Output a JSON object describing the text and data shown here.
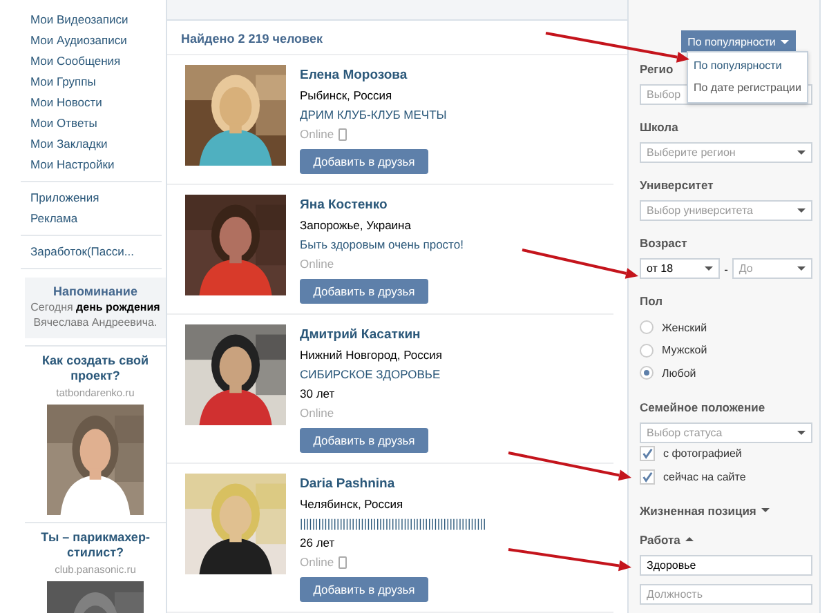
{
  "sidebar": {
    "menu_groups": [
      [
        "Мои Видеозаписи",
        "Мои Аудиозаписи",
        "Мои Сообщения",
        "Мои Группы",
        "Мои Новости",
        "Мои Ответы",
        "Мои Закладки",
        "Мои Настройки"
      ],
      [
        "Приложения",
        "Реклама"
      ],
      [
        "Заработок(Пасси..."
      ]
    ],
    "reminder": {
      "title": "Напоминание",
      "text": "Сегодня **день рождения** Вячеслава Андреевича."
    },
    "ads": [
      {
        "title": "Как создать свой проект?",
        "domain": "tatbondarenko.ru"
      },
      {
        "title": "Ты – парикмахер-стилист?",
        "domain": "club.panasonic.ru"
      }
    ]
  },
  "results": {
    "count": "Найдено 2 219 человек",
    "people": [
      {
        "name": "Елена Морозова",
        "city": "Рыбинск, Россия",
        "status": "ДРИМ КЛУБ-КЛУБ МЕЧТЫ",
        "online": "Online",
        "mobile": true,
        "button": "Добавить в друзья"
      },
      {
        "name": "Яна Костенко",
        "city": "Запорожье, Украина",
        "status": "Быть здоровым очень просто!",
        "online": "Online",
        "mobile": false,
        "button": "Добавить в друзья"
      },
      {
        "name": "Дмитрий Касаткин",
        "city": "Нижний Новгород, Россия",
        "status": "СИБИРСКОЕ ЗДОРОВЬЕ",
        "age": "30 лет",
        "online": "Online",
        "mobile": false,
        "button": "Добавить в друзья"
      },
      {
        "name": "Daria Pashnina",
        "city": "Челябинск, Россия",
        "status": "|||||||||||||||||||||||||||||||||||||||||||||||||||||||||||||",
        "age": "26 лет",
        "online": "Online",
        "mobile": true,
        "button": "Добавить в друзья"
      }
    ]
  },
  "sort": {
    "button": "По популярности",
    "options": [
      {
        "label": "По популярности",
        "selected": true
      },
      {
        "label": "По дате регистрации",
        "selected": false
      }
    ]
  },
  "filters": [
    {
      "kind": "heading",
      "label": "Регио"
    },
    {
      "kind": "select",
      "placeholder": "Выбор"
    },
    {
      "kind": "heading",
      "label": "Школа"
    },
    {
      "kind": "select",
      "placeholder": "Выберите регион"
    },
    {
      "kind": "heading",
      "label": "Университет"
    },
    {
      "kind": "select",
      "placeholder": "Выбор университета"
    },
    {
      "kind": "heading",
      "label": "Возраст"
    },
    {
      "kind": "range",
      "from": {
        "value": "от 18"
      },
      "separator": "-",
      "to": {
        "placeholder": "До"
      }
    },
    {
      "kind": "heading",
      "label": "Пол"
    },
    {
      "kind": "radio",
      "label": "Женский",
      "selected": false
    },
    {
      "kind": "radio",
      "label": "Мужской",
      "selected": false
    },
    {
      "kind": "radio",
      "label": "Любой",
      "selected": true
    },
    {
      "kind": "heading",
      "label": "Семейное положение"
    },
    {
      "kind": "select",
      "placeholder": "Выбор статуса"
    },
    {
      "kind": "checkbox",
      "label": "с фотографией",
      "checked": true
    },
    {
      "kind": "checkbox",
      "label": "сейчас на сайте",
      "checked": true
    },
    {
      "kind": "expander",
      "label": "Жизненная позиция",
      "expanded": false
    },
    {
      "kind": "expander",
      "label": "Работа",
      "expanded": true
    },
    {
      "kind": "input",
      "value": "Здоровье"
    },
    {
      "kind": "input",
      "placeholder": "Должность"
    }
  ]
}
